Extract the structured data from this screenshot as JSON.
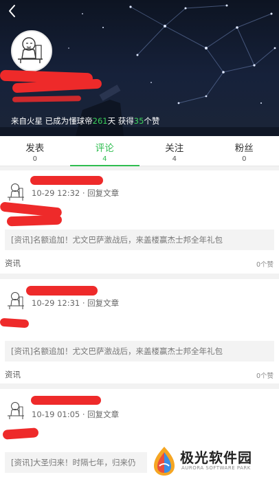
{
  "header": {
    "profile_prefix": "来自火星 已成为懂球帝",
    "days": "261",
    "days_suffix": "天 获得",
    "likes": "35",
    "likes_suffix": "个赞"
  },
  "tabs": [
    {
      "label": "发表",
      "count": "0"
    },
    {
      "label": "评论",
      "count": "4"
    },
    {
      "label": "关注",
      "count": "4"
    },
    {
      "label": "粉丝",
      "count": "0"
    }
  ],
  "comments": [
    {
      "time": "10-29 12:32",
      "reply": "· 回复文章",
      "article": "[资讯]名额追加！尤文巴萨激战后，来盖楼赢杰士邦全年礼包",
      "category": "资讯",
      "likes": "0个赞"
    },
    {
      "time": "10-29 12:31",
      "reply": "· 回复文章",
      "article": "[资讯]名额追加！尤文巴萨激战后，来盖楼赢杰士邦全年礼包",
      "category": "资讯",
      "likes": "0个赞"
    },
    {
      "time": "10-19 01:05",
      "reply": "· 回复文章",
      "article": "[资讯]大圣归来！时隔七年，归来仍",
      "category": "",
      "likes": ""
    }
  ],
  "watermark": {
    "title": "极光软件园",
    "subtitle": "AURORA SOFTWARE PARK"
  },
  "colors": {
    "accent": "#2ebd4f",
    "redaction": "#ee2a2a"
  },
  "icons": [
    "back-arrow-icon",
    "avatar-meme-image",
    "aurora-logo-icon"
  ]
}
